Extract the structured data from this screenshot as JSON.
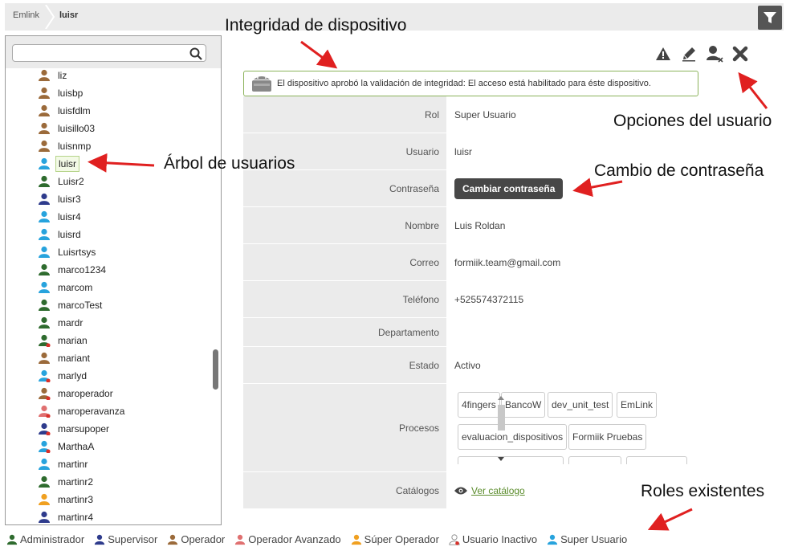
{
  "breadcrumb": [
    "Emlink",
    "luisr"
  ],
  "search": {
    "placeholder": "",
    "value": ""
  },
  "tree": [
    {
      "name": "liz",
      "role": "operador"
    },
    {
      "name": "luisbp",
      "role": "operador"
    },
    {
      "name": "luisfdlm",
      "role": "operador"
    },
    {
      "name": "luisillo03",
      "role": "operador"
    },
    {
      "name": "luisnmp",
      "role": "operador"
    },
    {
      "name": "luisr",
      "role": "super",
      "selected": true
    },
    {
      "name": "Luisr2",
      "role": "administrador"
    },
    {
      "name": "luisr3",
      "role": "supervisor"
    },
    {
      "name": "luisr4",
      "role": "super"
    },
    {
      "name": "luisrd",
      "role": "super"
    },
    {
      "name": "Luisrtsys",
      "role": "super"
    },
    {
      "name": "marco1234",
      "role": "administrador"
    },
    {
      "name": "marcom",
      "role": "super"
    },
    {
      "name": "marcoTest",
      "role": "administrador"
    },
    {
      "name": "mardr",
      "role": "administrador"
    },
    {
      "name": "marian",
      "role": "administrador-inactivo"
    },
    {
      "name": "mariant",
      "role": "operador"
    },
    {
      "name": "marlyd",
      "role": "super-inactivo"
    },
    {
      "name": "maroperador",
      "role": "operador-inactivo"
    },
    {
      "name": "maroperavanza",
      "role": "avanzado-inactivo"
    },
    {
      "name": "marsupoper",
      "role": "supervisor-inactivo"
    },
    {
      "name": "MarthaA",
      "role": "super-inactivo"
    },
    {
      "name": "martinr",
      "role": "super"
    },
    {
      "name": "martinr2",
      "role": "administrador"
    },
    {
      "name": "martinr3",
      "role": "super-operador"
    },
    {
      "name": "martinr4",
      "role": "supervisor"
    }
  ],
  "integrity": {
    "message": "El dispositivo aprobó la validación de integridad: El acceso está habilitado para éste dispositivo."
  },
  "fields": {
    "rol_label": "Rol",
    "rol_value": "Super Usuario",
    "usuario_label": "Usuario",
    "usuario_value": "luisr",
    "password_label": "Contraseña",
    "password_button": "Cambiar contraseña",
    "nombre_label": "Nombre",
    "nombre_value": "Luis Roldan",
    "correo_label": "Correo",
    "correo_value": "formiik.team@gmail.com",
    "telefono_label": "Teléfono",
    "telefono_value": "+525574372115",
    "departamento_label": "Departamento",
    "departamento_value": "",
    "estado_label": "Estado",
    "estado_value": "Activo",
    "procesos_label": "Procesos",
    "catalogos_label": "Catálogos",
    "catalogos_link": "Ver catálogo"
  },
  "procesos": [
    "4fingers",
    "BancoW",
    "dev_unit_test",
    "EmLink",
    "evaluacion_dispositivos",
    "Formiik Pruebas"
  ],
  "legend": [
    {
      "label": "Administrador",
      "color": "#2e6b2e"
    },
    {
      "label": "Supervisor",
      "color": "#2e3b8c"
    },
    {
      "label": "Operador",
      "color": "#9b6a3a"
    },
    {
      "label": "Operador Avanzado",
      "color": "#e07070"
    },
    {
      "label": "Súper Operador",
      "color": "#f0a020"
    },
    {
      "label": "Usuario Inactivo",
      "color": "#ffffff"
    },
    {
      "label": "Super Usuario",
      "color": "#27a3dd"
    }
  ],
  "annotations": {
    "integridad": "Integridad de dispositivo",
    "opciones": "Opciones del usuario",
    "arbol": "Árbol de usuarios",
    "cambio": "Cambio de contraseña",
    "roles": "Roles existentes"
  },
  "colors": {
    "administrador": "#2e6b2e",
    "supervisor": "#2e3b8c",
    "operador": "#9b6a3a",
    "avanzado": "#e07070",
    "super-operador": "#f0a020",
    "super": "#27a3dd",
    "inactive_dot": "#d9302a",
    "accent_green": "#8bb35a",
    "arrow_red": "#e02020"
  }
}
